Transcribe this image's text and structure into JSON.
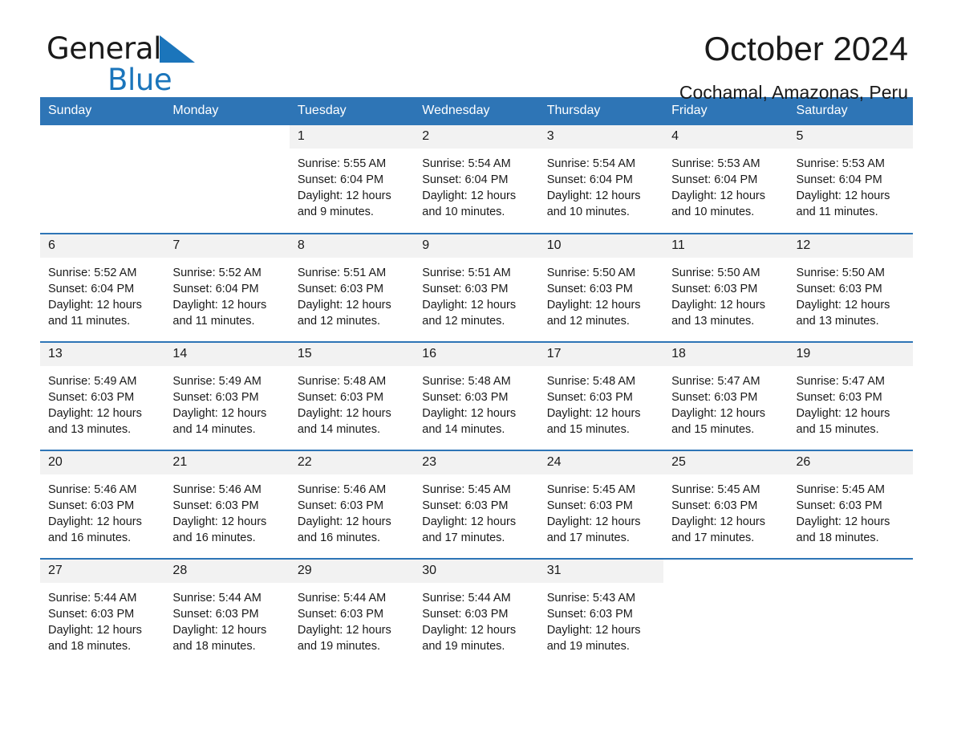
{
  "brand": {
    "name_part1": "General",
    "name_part2": "Blue",
    "triangle_color": "#1b75bb",
    "logo_icon": "general-blue-logo"
  },
  "header": {
    "title": "October 2024",
    "location": "Cochamal, Amazonas, Peru"
  },
  "colors": {
    "header_blue": "#2e75b6",
    "daynum_band": "#f2f2f2",
    "text": "#1a1a1a",
    "brand_blue": "#1b75bb"
  },
  "weekday_headers": [
    "Sunday",
    "Monday",
    "Tuesday",
    "Wednesday",
    "Thursday",
    "Friday",
    "Saturday"
  ],
  "labels": {
    "sunrise_prefix": "Sunrise:",
    "sunset_prefix": "Sunset:",
    "daylight_prefix": "Daylight:"
  },
  "weeks": [
    [
      {
        "day": "",
        "blank": true,
        "line1": "",
        "line2": "",
        "line3": "",
        "line4": ""
      },
      {
        "day": "",
        "blank": true,
        "line1": "",
        "line2": "",
        "line3": "",
        "line4": ""
      },
      {
        "day": "1",
        "line1": "Sunrise: 5:55 AM",
        "line2": "Sunset: 6:04 PM",
        "line3": "Daylight: 12 hours",
        "line4": "and 9 minutes."
      },
      {
        "day": "2",
        "line1": "Sunrise: 5:54 AM",
        "line2": "Sunset: 6:04 PM",
        "line3": "Daylight: 12 hours",
        "line4": "and 10 minutes."
      },
      {
        "day": "3",
        "line1": "Sunrise: 5:54 AM",
        "line2": "Sunset: 6:04 PM",
        "line3": "Daylight: 12 hours",
        "line4": "and 10 minutes."
      },
      {
        "day": "4",
        "line1": "Sunrise: 5:53 AM",
        "line2": "Sunset: 6:04 PM",
        "line3": "Daylight: 12 hours",
        "line4": "and 10 minutes."
      },
      {
        "day": "5",
        "line1": "Sunrise: 5:53 AM",
        "line2": "Sunset: 6:04 PM",
        "line3": "Daylight: 12 hours",
        "line4": "and 11 minutes."
      }
    ],
    [
      {
        "day": "6",
        "line1": "Sunrise: 5:52 AM",
        "line2": "Sunset: 6:04 PM",
        "line3": "Daylight: 12 hours",
        "line4": "and 11 minutes."
      },
      {
        "day": "7",
        "line1": "Sunrise: 5:52 AM",
        "line2": "Sunset: 6:04 PM",
        "line3": "Daylight: 12 hours",
        "line4": "and 11 minutes."
      },
      {
        "day": "8",
        "line1": "Sunrise: 5:51 AM",
        "line2": "Sunset: 6:03 PM",
        "line3": "Daylight: 12 hours",
        "line4": "and 12 minutes."
      },
      {
        "day": "9",
        "line1": "Sunrise: 5:51 AM",
        "line2": "Sunset: 6:03 PM",
        "line3": "Daylight: 12 hours",
        "line4": "and 12 minutes."
      },
      {
        "day": "10",
        "line1": "Sunrise: 5:50 AM",
        "line2": "Sunset: 6:03 PM",
        "line3": "Daylight: 12 hours",
        "line4": "and 12 minutes."
      },
      {
        "day": "11",
        "line1": "Sunrise: 5:50 AM",
        "line2": "Sunset: 6:03 PM",
        "line3": "Daylight: 12 hours",
        "line4": "and 13 minutes."
      },
      {
        "day": "12",
        "line1": "Sunrise: 5:50 AM",
        "line2": "Sunset: 6:03 PM",
        "line3": "Daylight: 12 hours",
        "line4": "and 13 minutes."
      }
    ],
    [
      {
        "day": "13",
        "line1": "Sunrise: 5:49 AM",
        "line2": "Sunset: 6:03 PM",
        "line3": "Daylight: 12 hours",
        "line4": "and 13 minutes."
      },
      {
        "day": "14",
        "line1": "Sunrise: 5:49 AM",
        "line2": "Sunset: 6:03 PM",
        "line3": "Daylight: 12 hours",
        "line4": "and 14 minutes."
      },
      {
        "day": "15",
        "line1": "Sunrise: 5:48 AM",
        "line2": "Sunset: 6:03 PM",
        "line3": "Daylight: 12 hours",
        "line4": "and 14 minutes."
      },
      {
        "day": "16",
        "line1": "Sunrise: 5:48 AM",
        "line2": "Sunset: 6:03 PM",
        "line3": "Daylight: 12 hours",
        "line4": "and 14 minutes."
      },
      {
        "day": "17",
        "line1": "Sunrise: 5:48 AM",
        "line2": "Sunset: 6:03 PM",
        "line3": "Daylight: 12 hours",
        "line4": "and 15 minutes."
      },
      {
        "day": "18",
        "line1": "Sunrise: 5:47 AM",
        "line2": "Sunset: 6:03 PM",
        "line3": "Daylight: 12 hours",
        "line4": "and 15 minutes."
      },
      {
        "day": "19",
        "line1": "Sunrise: 5:47 AM",
        "line2": "Sunset: 6:03 PM",
        "line3": "Daylight: 12 hours",
        "line4": "and 15 minutes."
      }
    ],
    [
      {
        "day": "20",
        "line1": "Sunrise: 5:46 AM",
        "line2": "Sunset: 6:03 PM",
        "line3": "Daylight: 12 hours",
        "line4": "and 16 minutes."
      },
      {
        "day": "21",
        "line1": "Sunrise: 5:46 AM",
        "line2": "Sunset: 6:03 PM",
        "line3": "Daylight: 12 hours",
        "line4": "and 16 minutes."
      },
      {
        "day": "22",
        "line1": "Sunrise: 5:46 AM",
        "line2": "Sunset: 6:03 PM",
        "line3": "Daylight: 12 hours",
        "line4": "and 16 minutes."
      },
      {
        "day": "23",
        "line1": "Sunrise: 5:45 AM",
        "line2": "Sunset: 6:03 PM",
        "line3": "Daylight: 12 hours",
        "line4": "and 17 minutes."
      },
      {
        "day": "24",
        "line1": "Sunrise: 5:45 AM",
        "line2": "Sunset: 6:03 PM",
        "line3": "Daylight: 12 hours",
        "line4": "and 17 minutes."
      },
      {
        "day": "25",
        "line1": "Sunrise: 5:45 AM",
        "line2": "Sunset: 6:03 PM",
        "line3": "Daylight: 12 hours",
        "line4": "and 17 minutes."
      },
      {
        "day": "26",
        "line1": "Sunrise: 5:45 AM",
        "line2": "Sunset: 6:03 PM",
        "line3": "Daylight: 12 hours",
        "line4": "and 18 minutes."
      }
    ],
    [
      {
        "day": "27",
        "line1": "Sunrise: 5:44 AM",
        "line2": "Sunset: 6:03 PM",
        "line3": "Daylight: 12 hours",
        "line4": "and 18 minutes."
      },
      {
        "day": "28",
        "line1": "Sunrise: 5:44 AM",
        "line2": "Sunset: 6:03 PM",
        "line3": "Daylight: 12 hours",
        "line4": "and 18 minutes."
      },
      {
        "day": "29",
        "line1": "Sunrise: 5:44 AM",
        "line2": "Sunset: 6:03 PM",
        "line3": "Daylight: 12 hours",
        "line4": "and 19 minutes."
      },
      {
        "day": "30",
        "line1": "Sunrise: 5:44 AM",
        "line2": "Sunset: 6:03 PM",
        "line3": "Daylight: 12 hours",
        "line4": "and 19 minutes."
      },
      {
        "day": "31",
        "line1": "Sunrise: 5:43 AM",
        "line2": "Sunset: 6:03 PM",
        "line3": "Daylight: 12 hours",
        "line4": "and 19 minutes."
      },
      {
        "day": "",
        "blank": true,
        "line1": "",
        "line2": "",
        "line3": "",
        "line4": ""
      },
      {
        "day": "",
        "blank": true,
        "line1": "",
        "line2": "",
        "line3": "",
        "line4": ""
      }
    ]
  ]
}
